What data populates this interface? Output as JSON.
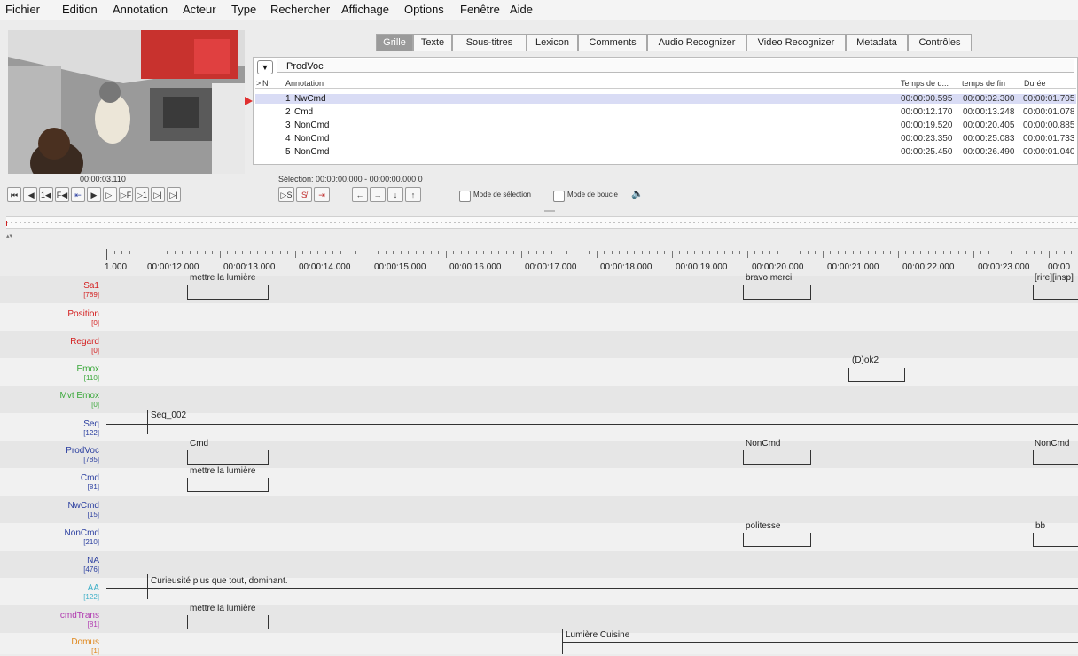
{
  "menu": [
    "Fichier",
    "Edition",
    "Annotation",
    "Acteur",
    "Type",
    "Rechercher",
    "Affichage",
    "Options",
    "Fenêtre",
    "Aide"
  ],
  "video": {
    "time": "00:00:03.110"
  },
  "selection": "Sélection: 00:00:00.000 - 00:00:00.000  0",
  "controls": {
    "mode_selection": "Mode de sélection",
    "mode_boucle": "Mode de boucle"
  },
  "tabs": [
    "Grille",
    "Texte",
    "Sous-titres",
    "Lexicon",
    "Comments",
    "Audio Recognizer",
    "Video Recognizer",
    "Metadata",
    "Contrôles"
  ],
  "grid": {
    "tier": "ProdVoc",
    "headers": {
      "arrow": ">",
      "nr": "Nr",
      "annotation": "Annotation",
      "start": "Temps de d...",
      "end": "temps de fin",
      "dur": "Durée"
    },
    "rows": [
      {
        "nr": "1",
        "annotation": "NwCmd",
        "start": "00:00:00.595",
        "end": "00:00:02.300",
        "dur": "00:00:01.705"
      },
      {
        "nr": "2",
        "annotation": "Cmd",
        "start": "00:00:12.170",
        "end": "00:00:13.248",
        "dur": "00:00:01.078"
      },
      {
        "nr": "3",
        "annotation": "NonCmd",
        "start": "00:00:19.520",
        "end": "00:00:20.405",
        "dur": "00:00:00.885"
      },
      {
        "nr": "4",
        "annotation": "NonCmd",
        "start": "00:00:23.350",
        "end": "00:00:25.083",
        "dur": "00:00:01.733"
      },
      {
        "nr": "5",
        "annotation": "NonCmd",
        "start": "00:00:25.450",
        "end": "00:00:26.490",
        "dur": "00:00:01.040"
      }
    ]
  },
  "ruler": [
    "1.000",
    "00:00:12.000",
    "00:00:13.000",
    "00:00:14.000",
    "00:00:15.000",
    "00:00:16.000",
    "00:00:17.000",
    "00:00:18.000",
    "00:00:19.000",
    "00:00:20.000",
    "00:00:21.000",
    "00:00:22.000",
    "00:00:23.000",
    "00:00"
  ],
  "tiers": [
    {
      "name": "Sa1",
      "count": "[789]",
      "color": "#d42020"
    },
    {
      "name": "Position",
      "count": "[0]",
      "color": "#d42020"
    },
    {
      "name": "Regard",
      "count": "[0]",
      "color": "#d42020"
    },
    {
      "name": "Emox",
      "count": "[110]",
      "color": "#3aa83a"
    },
    {
      "name": "Mvt Emox",
      "count": "[0]",
      "color": "#3aa83a"
    },
    {
      "name": "Seq",
      "count": "[122]",
      "color": "#2b3fa0"
    },
    {
      "name": "ProdVoc",
      "count": "[785]",
      "color": "#2b3fa0"
    },
    {
      "name": "Cmd",
      "count": "[81]",
      "color": "#2b3fa0"
    },
    {
      "name": "NwCmd",
      "count": "[15]",
      "color": "#2b3fa0"
    },
    {
      "name": "NonCmd",
      "count": "[210]",
      "color": "#2b3fa0"
    },
    {
      "name": "NA",
      "count": "[476]",
      "color": "#2b3fa0"
    },
    {
      "name": "AA",
      "count": "[122]",
      "color": "#40b0c8"
    },
    {
      "name": "cmdTrans",
      "count": "[81]",
      "color": "#b03ab0"
    },
    {
      "name": "Domus",
      "count": "[1]",
      "color": "#e08a20"
    }
  ],
  "annotations": {
    "sa1_1": "mettre la lumière",
    "sa1_2": "bravo merci",
    "sa1_3": "[rire][insp]",
    "emox_1": "(D)ok2",
    "seq_1": "Seq_002",
    "prodvoc_1": "Cmd",
    "prodvoc_2": "NonCmd",
    "prodvoc_3": "NonCmd",
    "cmd_1": "mettre la lumière",
    "noncmd_1": "politesse",
    "noncmd_2": "bb",
    "aa_1": "Curieusité plus que tout, dominant.",
    "cmdtrans_1": "mettre la lumière",
    "domus_1": "Lumière Cuisine"
  }
}
